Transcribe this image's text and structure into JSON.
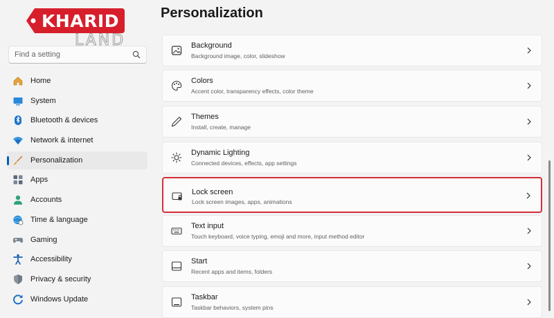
{
  "logo": {
    "brand": "KHARID",
    "sub": "LAND",
    "color": "#d71f2c"
  },
  "search": {
    "placeholder": "Find a setting",
    "icon": "search-icon"
  },
  "sidebar": {
    "items": [
      {
        "label": "Home",
        "icon": "home-icon"
      },
      {
        "label": "System",
        "icon": "monitor-icon"
      },
      {
        "label": "Bluetooth & devices",
        "icon": "bluetooth-icon"
      },
      {
        "label": "Network & internet",
        "icon": "wifi-icon"
      },
      {
        "label": "Personalization",
        "icon": "brush-icon",
        "active": true
      },
      {
        "label": "Apps",
        "icon": "apps-icon"
      },
      {
        "label": "Accounts",
        "icon": "user-icon"
      },
      {
        "label": "Time & language",
        "icon": "globe-clock-icon"
      },
      {
        "label": "Gaming",
        "icon": "gamepad-icon"
      },
      {
        "label": "Accessibility",
        "icon": "accessibility-icon"
      },
      {
        "label": "Privacy & security",
        "icon": "shield-icon"
      },
      {
        "label": "Windows Update",
        "icon": "update-icon"
      }
    ]
  },
  "main": {
    "title": "Personalization",
    "cards": [
      {
        "title": "Background",
        "desc": "Background image, color, slideshow",
        "icon": "image-icon"
      },
      {
        "title": "Colors",
        "desc": "Accent color, transparency effects, color theme",
        "icon": "palette-icon"
      },
      {
        "title": "Themes",
        "desc": "Install, create, manage",
        "icon": "pen-icon"
      },
      {
        "title": "Dynamic Lighting",
        "desc": "Connected devices, effects, app settings",
        "icon": "sun-icon"
      },
      {
        "title": "Lock screen",
        "desc": "Lock screen images, apps, animations",
        "icon": "lock-screen-icon",
        "highlighted": true
      },
      {
        "title": "Text input",
        "desc": "Touch keyboard, voice typing, emoji and more, input method editor",
        "icon": "keyboard-icon"
      },
      {
        "title": "Start",
        "desc": "Recent apps and items, folders",
        "icon": "start-icon"
      },
      {
        "title": "Taskbar",
        "desc": "Taskbar behaviors, system pins",
        "icon": "taskbar-icon"
      }
    ]
  },
  "colors": {
    "accent": "#005fb8",
    "highlight_border": "#d32f3a"
  }
}
